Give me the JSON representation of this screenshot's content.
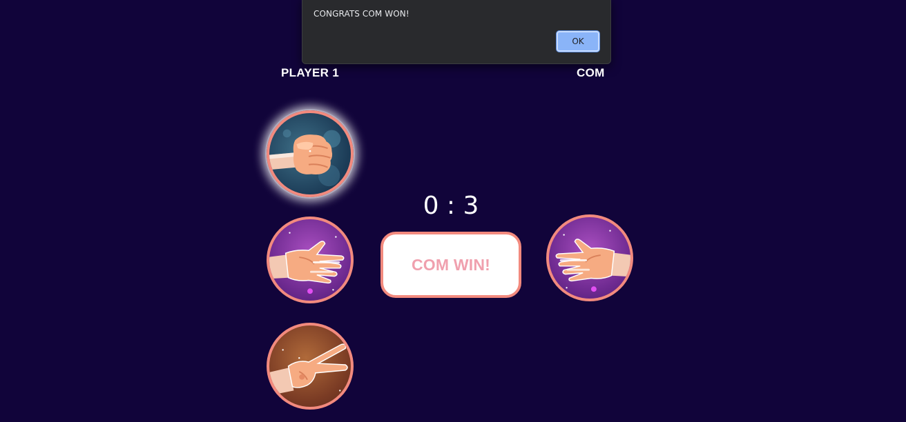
{
  "dialog": {
    "message": "CONGRATS COM WON!",
    "ok_label": "OK"
  },
  "players": {
    "player1_label": "PLAYER 1",
    "com_label": "COM"
  },
  "score": {
    "text": "0 : 3",
    "player1": 0,
    "com": 3
  },
  "result": {
    "text": "COM WIN!"
  },
  "player1_choices": [
    {
      "name": "rock",
      "icon": "rock-hand-icon",
      "selected": true
    },
    {
      "name": "paper",
      "icon": "paper-hand-icon",
      "selected": false
    },
    {
      "name": "scissors",
      "icon": "scissors-hand-icon",
      "selected": false
    }
  ],
  "com_choice": {
    "name": "paper",
    "icon": "paper-hand-icon"
  },
  "colors": {
    "background": "#11043a",
    "accent_border": "#f28a7e",
    "result_text": "#f0a0ae",
    "dialog_bg": "#292a2d",
    "ok_button": "#8ab4f8"
  }
}
